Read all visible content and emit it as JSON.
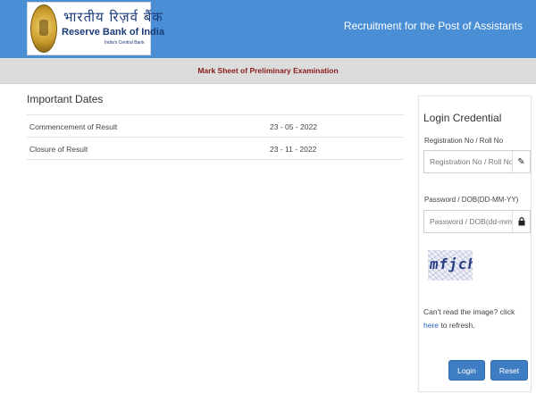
{
  "header": {
    "logo": {
      "hindi": "भारतीय रिज़र्व बैंक",
      "english": "Reserve Bank of India",
      "sub": "India's Central Bank"
    },
    "title": "Recruitment for the Post of Assistants",
    "bg_color": "#4a8fd6"
  },
  "subheader": {
    "title": "Mark Sheet of Preliminary Examination",
    "color": "#8b1a1a"
  },
  "important_dates": {
    "title": "Important Dates",
    "rows": [
      {
        "label": "Commencement of Result",
        "value": "23 - 05 - 2022"
      },
      {
        "label": "Closure of Result",
        "value": "23 - 11 - 2022"
      }
    ]
  },
  "login": {
    "title": "Login Credential",
    "registration": {
      "label": "Registration No / Roll No",
      "placeholder": "Registration No / Roll No",
      "icon": "pencil-icon"
    },
    "password": {
      "label": "Password / DOB(DD-MM-YY)",
      "placeholder": "Password / DOB(dd-mm-yy)",
      "icon": "lock-icon"
    },
    "captcha_text": "mfjch",
    "refresh_prefix": "Can't read the image? click ",
    "refresh_link": "here",
    "refresh_suffix": " to refresh.",
    "login_label": "Login",
    "reset_label": "Reset",
    "button_color": "#3f7dc3"
  }
}
